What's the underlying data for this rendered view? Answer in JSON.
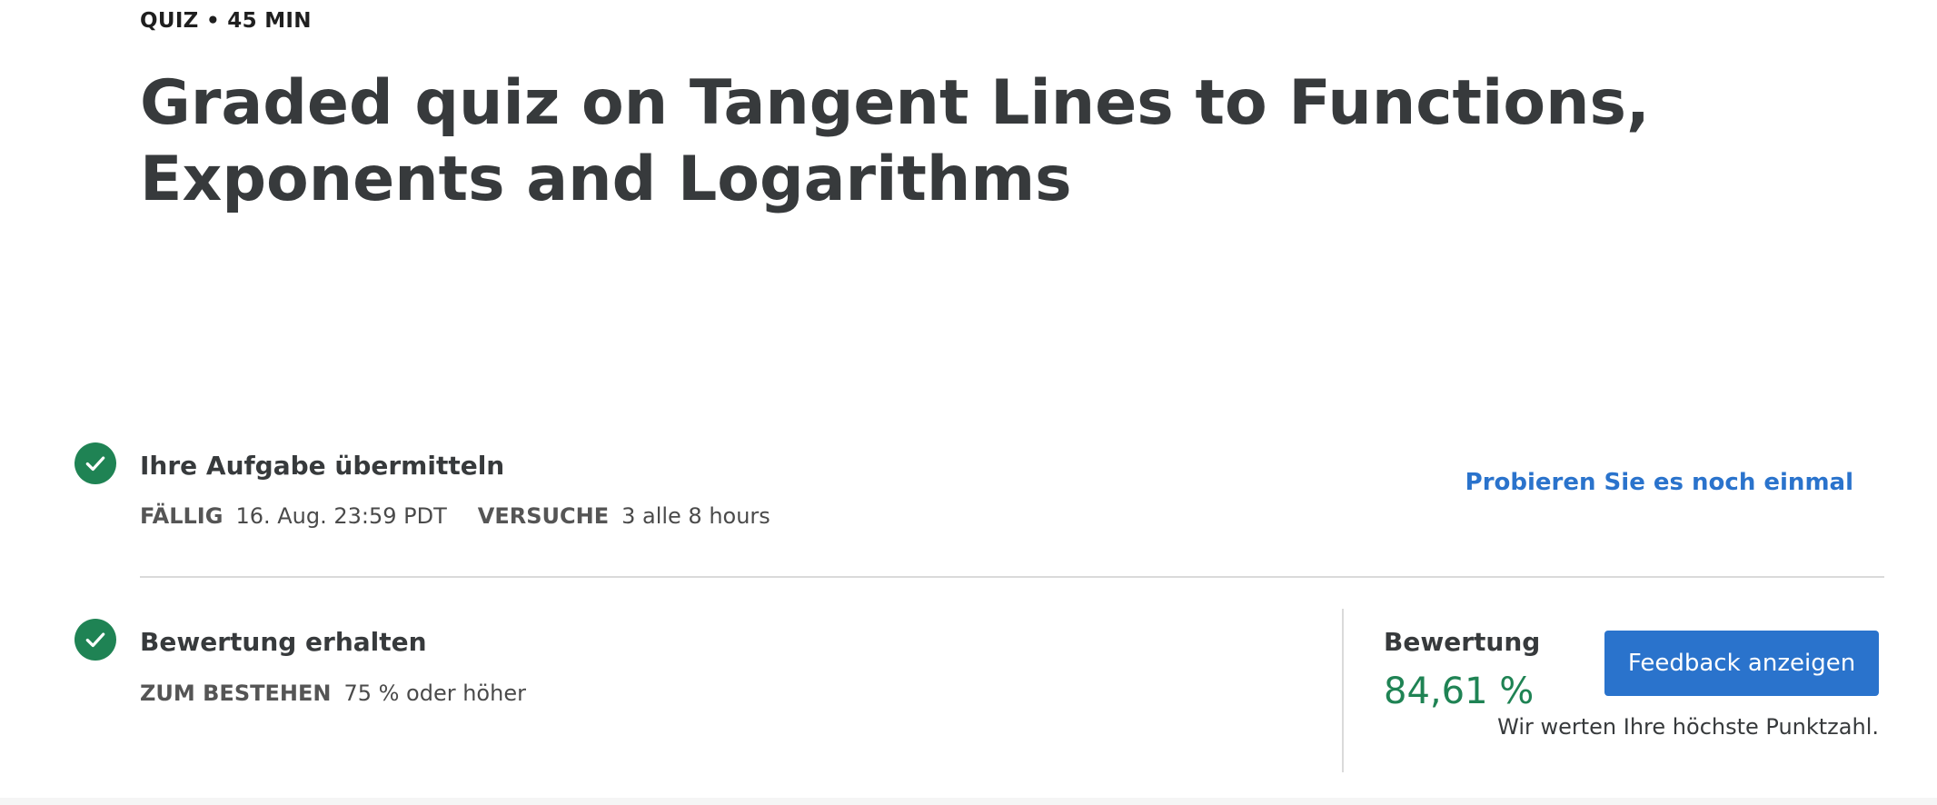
{
  "header": {
    "eyebrow": "QUIZ • 45 MIN",
    "title": "Graded quiz on Tangent Lines to Functions, Exponents and Logarithms"
  },
  "submit_step": {
    "title": "Ihre Aufgabe übermitteln",
    "due_label": "FÄLLIG",
    "due_value": "16. Aug. 23:59 PDT",
    "attempts_label": "VERSUCHE",
    "attempts_value": "3 alle 8 hours",
    "retry_link": "Probieren Sie es noch einmal",
    "icon": "check-icon"
  },
  "grade_step": {
    "title": "Bewertung erhalten",
    "pass_label": "ZUM BESTEHEN",
    "pass_value": "75 % oder höher",
    "icon": "check-icon"
  },
  "grade": {
    "label": "Bewertung",
    "value": "84,61 %",
    "feedback_button": "Feedback anzeigen",
    "note": "Wir werten Ihre höchste Punktzahl."
  },
  "colors": {
    "success": "#1f8354",
    "accent": "#2a73cc"
  }
}
